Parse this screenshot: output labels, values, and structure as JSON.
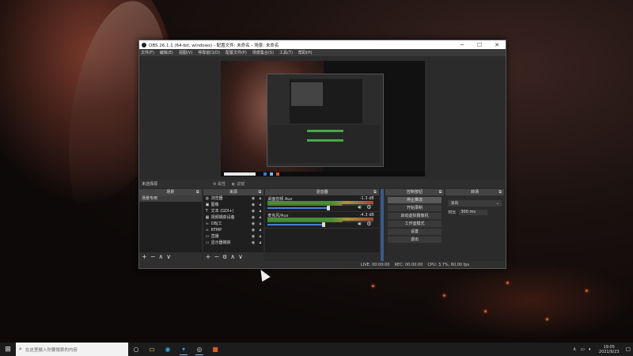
{
  "window": {
    "title": "OBS 26.1.1 (64-bit, windows) - 配置文件: 未命名 - 场景: 未命名",
    "minimize": "─",
    "maximize": "☐",
    "close": "✕"
  },
  "menu": [
    "文件(F)",
    "编辑(E)",
    "视图(V)",
    "停靠窗口(D)",
    "配置文件(P)",
    "场景集合(S)",
    "工具(T)",
    "帮助(H)"
  ],
  "scene_bar": {
    "label": "未选择源",
    "properties": "属性",
    "filters": "滤镜"
  },
  "docks": {
    "scenes": {
      "title": "场景",
      "items": [
        "场景专用"
      ]
    },
    "sources": {
      "title": "来源",
      "items": [
        {
          "icon": "globe-icon",
          "glyph": "◍",
          "label": "浏览器"
        },
        {
          "icon": "image-icon",
          "glyph": "▣",
          "label": "图像"
        },
        {
          "icon": "text-icon",
          "glyph": "T",
          "label": "文本 (GDI+)"
        },
        {
          "icon": "camera-icon",
          "glyph": "▦",
          "label": "视频捕获设备"
        },
        {
          "icon": "link-icon",
          "glyph": "∞",
          "label": "OBJ工"
        },
        {
          "icon": "link-icon",
          "glyph": "∞",
          "label": "RTMP"
        },
        {
          "icon": "capture-icon",
          "glyph": "▭",
          "label": "直播"
        },
        {
          "icon": "monitor-icon",
          "glyph": "▭",
          "label": "显示器捕获"
        }
      ]
    },
    "mixer": {
      "title": "混音器",
      "tracks": [
        {
          "name": "桌面音频 Aux",
          "db": "-1.3 dB",
          "level": 0.74
        },
        {
          "name": "麦克风/Aux",
          "db": "-4.3 dB",
          "level": 0.68
        }
      ]
    },
    "transitions": {
      "title": "转场",
      "selected": "淡出",
      "duration_label": "时长",
      "duration": "300 ms"
    },
    "controls": {
      "title": "控制按钮",
      "buttons": [
        "停止推流",
        "开始录制",
        "启动虚拟摄像机",
        "工作室模式",
        "设置",
        "退出"
      ]
    }
  },
  "footer_icons": {
    "add": "+",
    "remove": "−",
    "up": "∧",
    "down": "∨",
    "settings": "⚙"
  },
  "status": {
    "live": "LIVE: 00:00:00",
    "rec": "REC: 00:00:00",
    "cpu": "CPU: 3.7%, 60.00 fps",
    "bitrate": "12 kb"
  },
  "taskbar": {
    "search_placeholder": "在这里输入你要搜索的内容",
    "time": "19:05",
    "date": "2021/9/23"
  }
}
